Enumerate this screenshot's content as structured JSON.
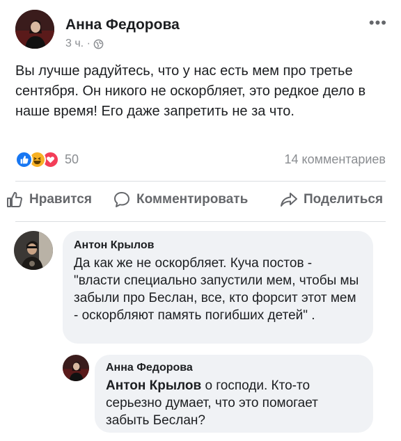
{
  "post": {
    "author": "Анна Федорова",
    "time": "3 ч. ·",
    "privacy_icon": "globe-icon",
    "text": "Вы лучше радуйтесь, что у нас есть мем про третье сентября. Он никого не оскорбляет, это редкое дело в наше время! Его даже запретить не за что.",
    "reaction_count": "50",
    "reactions": [
      "like",
      "haha",
      "love"
    ],
    "comments_count": "14 комментариев"
  },
  "actions": {
    "like": "Нравится",
    "comment": "Комментировать",
    "share": "Поделиться"
  },
  "comments": [
    {
      "author": "Антон Крылов",
      "text": "Да как же не оскорбляет. Куча постов - \"власти специально запустили мем, чтобы мы забыли про Беслан, все, кто форсит этот мем - оскорбляют память погибших детей\" ."
    },
    {
      "author": "Анна Федорова",
      "mention": "Антон Крылов",
      "text": "о господи. Кто-то серьезно думает, что это помогает забыть Беслан?"
    }
  ],
  "colors": {
    "like": "#1877f2",
    "haha": "#f7b125",
    "love": "#f33e58",
    "muted": "#8a8d91",
    "bubble": "#f0f2f5"
  }
}
